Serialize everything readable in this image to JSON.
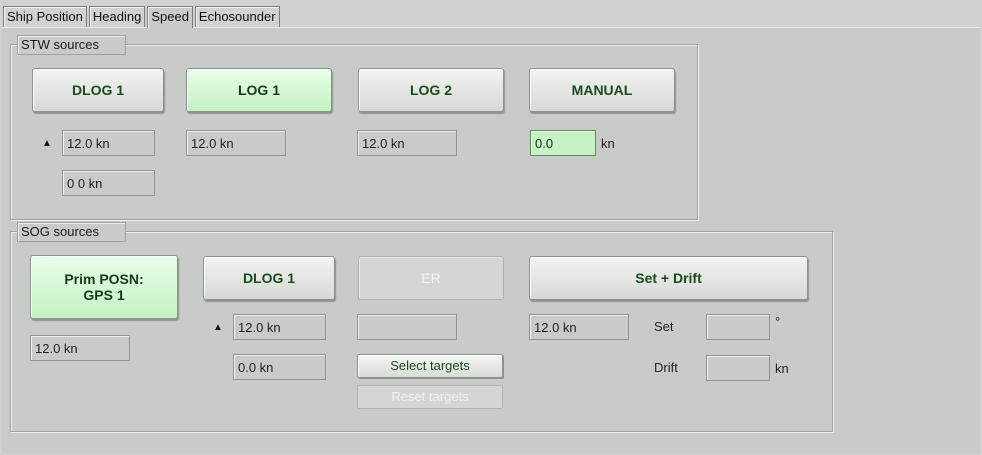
{
  "tabs": [
    {
      "label": "Ship Position",
      "active": false
    },
    {
      "label": "Heading",
      "active": false
    },
    {
      "label": "Speed",
      "active": true
    },
    {
      "label": "Echosounder",
      "active": false
    }
  ],
  "stw": {
    "title": "STW sources",
    "buttons": {
      "dlog1": "DLOG 1",
      "log1": "LOG 1",
      "log2": "LOG 2",
      "manual": "MANUAL"
    },
    "selected": "LOG 1",
    "values": {
      "dlog1_speed": "12.0 kn",
      "dlog1_secondary": "0 0 kn",
      "log1_speed": "12.0 kn",
      "log2_speed": "12.0 kn",
      "manual_value": "0.0",
      "manual_unit": "kn"
    }
  },
  "sog": {
    "title": "SOG sources",
    "buttons": {
      "prim_posn": "Prim POSN:\nGPS 1",
      "dlog1": "DLOG 1",
      "er": "ER",
      "set_drift": "Set + Drift",
      "select_targets": "Select targets",
      "reset_targets": "Reset targets"
    },
    "selected": "Prim POSN: GPS 1",
    "values": {
      "prim_speed": "12.0 kn",
      "dlog1_speed": "12.0 kn",
      "dlog1_secondary": "0.0 kn",
      "er_speed": "",
      "set_drift_speed": "12.0 kn",
      "set_label": "Set",
      "set_value": "",
      "set_unit": "°",
      "drift_label": "Drift",
      "drift_value": "",
      "drift_unit": "kn"
    }
  },
  "icons": {
    "up_arrow": "▲"
  },
  "colors": {
    "selected_button": "#c4f2c4",
    "input_field": "#c6f2c6",
    "button_text": "#1c4a1c",
    "panel_background": "#c8ccc8"
  }
}
